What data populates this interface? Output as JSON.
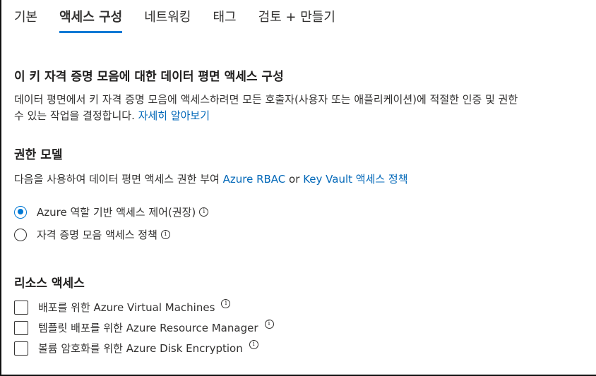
{
  "tabs": [
    {
      "label": "기본",
      "active": false
    },
    {
      "label": "액세스 구성",
      "active": true
    },
    {
      "label": "네트워킹",
      "active": false
    },
    {
      "label": "태그",
      "active": false
    },
    {
      "label": "검토 + 만들기",
      "active": false
    }
  ],
  "section_main": {
    "title": "이 키 자격 증명 모음에 대한 데이터 평면 액세스 구성",
    "description_line1": "데이터 평면에서 키 자격 증명 모음에 액세스하려면 모든 호출자(사용자 또는 애플리케이션)에 적절한 인증 및 권한",
    "description_line2": "수 있는 작업을 결정합니다.",
    "learn_more_link": "자세히 알아보기"
  },
  "permission_model": {
    "title": "권한 모델",
    "intro_text": "다음을 사용하여 데이터 평면 액세스 권한 부여",
    "link_rbac": "Azure RBAC",
    "or_text": "or",
    "link_policy": "Key Vault 액세스 정책",
    "options": [
      {
        "label": "Azure 역할 기반 액세스 제어(권장)",
        "selected": true
      },
      {
        "label": "자격 증명 모음 액세스 정책",
        "selected": false
      }
    ]
  },
  "resource_access": {
    "title": "리소스 액세스",
    "items": [
      {
        "label": "배포를 위한 Azure Virtual Machines",
        "checked": false
      },
      {
        "label": "템플릿 배포를 위한 Azure Resource Manager",
        "checked": false
      },
      {
        "label": "볼륨 암호화를 위한 Azure Disk Encryption",
        "checked": false
      }
    ]
  },
  "info_glyph": "i",
  "colors": {
    "accent": "#0078d4",
    "link": "#0067b8",
    "text": "#323130"
  }
}
